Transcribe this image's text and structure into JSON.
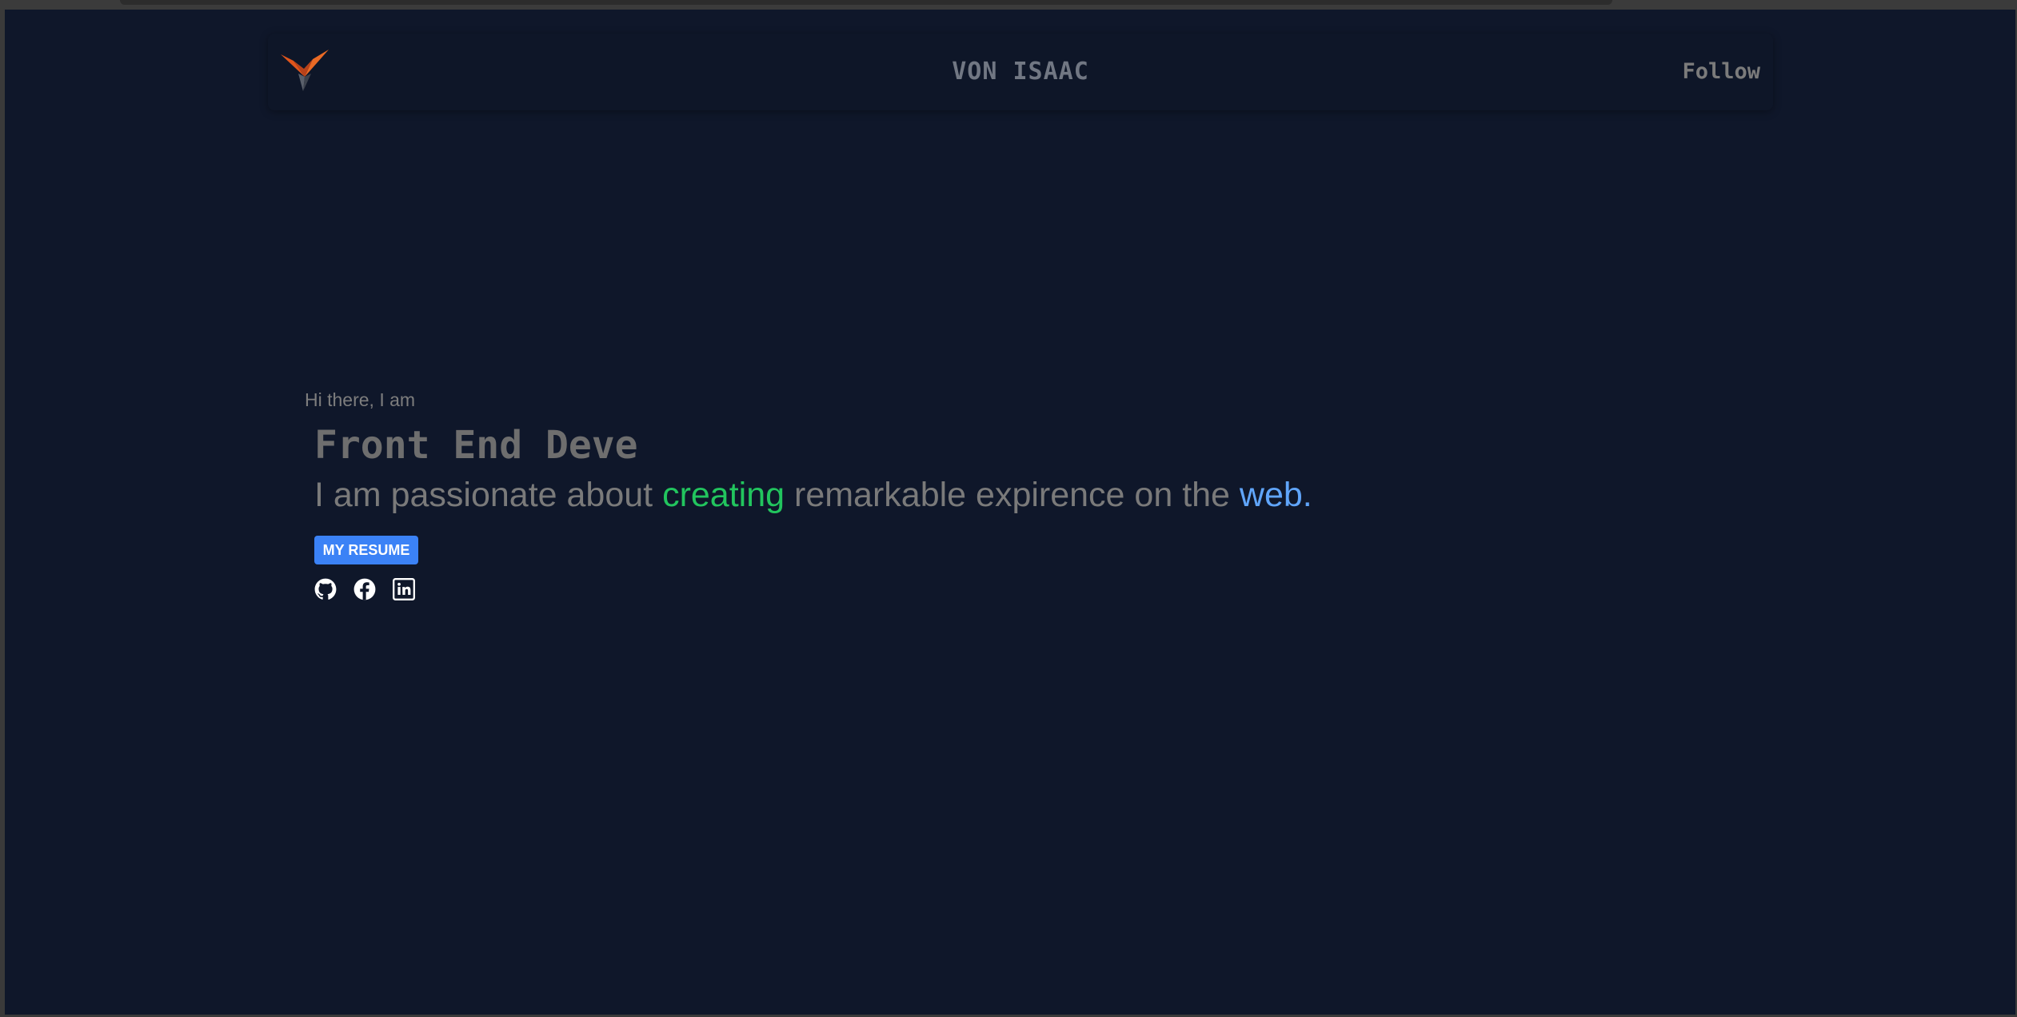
{
  "navbar": {
    "brand": "VON ISAAC",
    "follow_label": "Follow",
    "logo_icon": "v-chevron-logo-icon"
  },
  "hero": {
    "greeting": "Hi there, I am",
    "role": "Front End Deve",
    "tagline": {
      "part1": "I am passionate about ",
      "highlight1": "creating",
      "part2": " remarkable expirence on the ",
      "highlight2": "web."
    },
    "resume_label": "MY RESUME",
    "socials": [
      {
        "icon": "github-icon"
      },
      {
        "icon": "facebook-icon"
      },
      {
        "icon": "linkedin-icon"
      }
    ]
  },
  "colors": {
    "background": "#0f172a",
    "accent_green": "#22c55e",
    "accent_blue": "#60a5fa",
    "button": "#3b82f6",
    "logo": "#e05a1e"
  }
}
